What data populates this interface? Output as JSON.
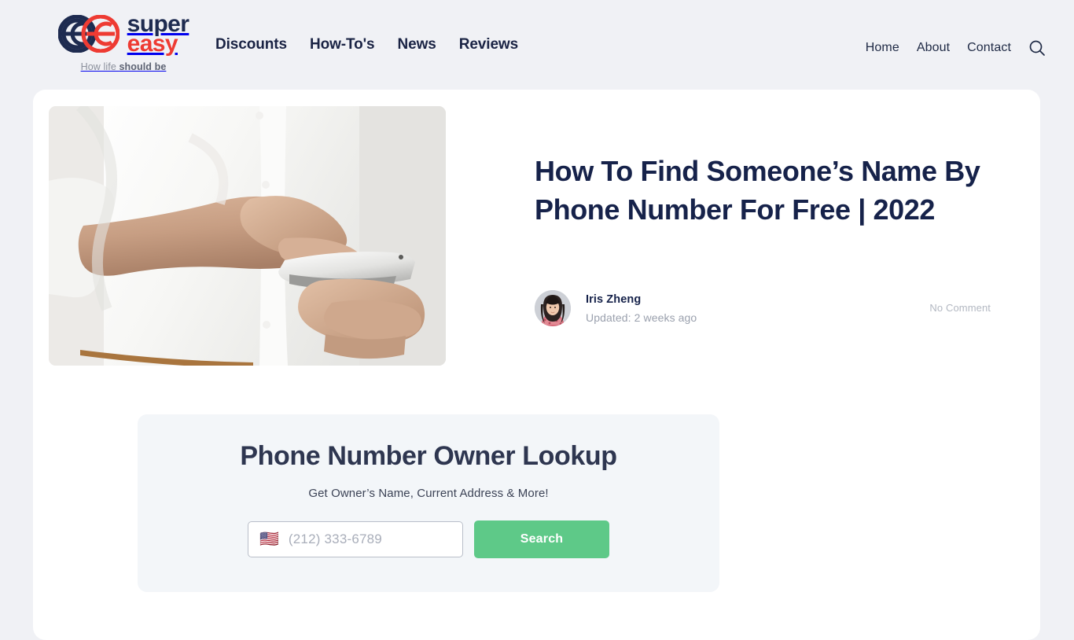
{
  "brand": {
    "logo_icon": "double-e-circles-logo",
    "word_top": "super",
    "word_bottom": "easy",
    "tagline_plain": "How life ",
    "tagline_bold": "should be",
    "navy": "#1e2b50",
    "red": "#ee3b33"
  },
  "nav": {
    "main": [
      {
        "label": "Discounts"
      },
      {
        "label": "How-To's"
      },
      {
        "label": "News"
      },
      {
        "label": "Reviews"
      }
    ],
    "util": [
      {
        "label": "Home"
      },
      {
        "label": "About"
      },
      {
        "label": "Contact"
      }
    ],
    "search_icon": "search-icon"
  },
  "article": {
    "title": "How To Find Someone’s Name By Phone Number For Free | 2022",
    "hero_alt": "man-in-white-shirt-using-smartphone",
    "author": "Iris Zheng",
    "updated": "Updated: 2 weeks ago",
    "comments": "No Comment",
    "avatar_alt": "author-avatar-iris-zheng"
  },
  "lookup": {
    "title": "Phone Number Owner Lookup",
    "subtitle": "Get Owner’s Name, Current Address & More!",
    "flag_icon": "🇺🇸",
    "phone_placeholder": "(212) 333-6789",
    "phone_value": "",
    "submit_label": "Search",
    "accent_green": "#5ec988"
  }
}
